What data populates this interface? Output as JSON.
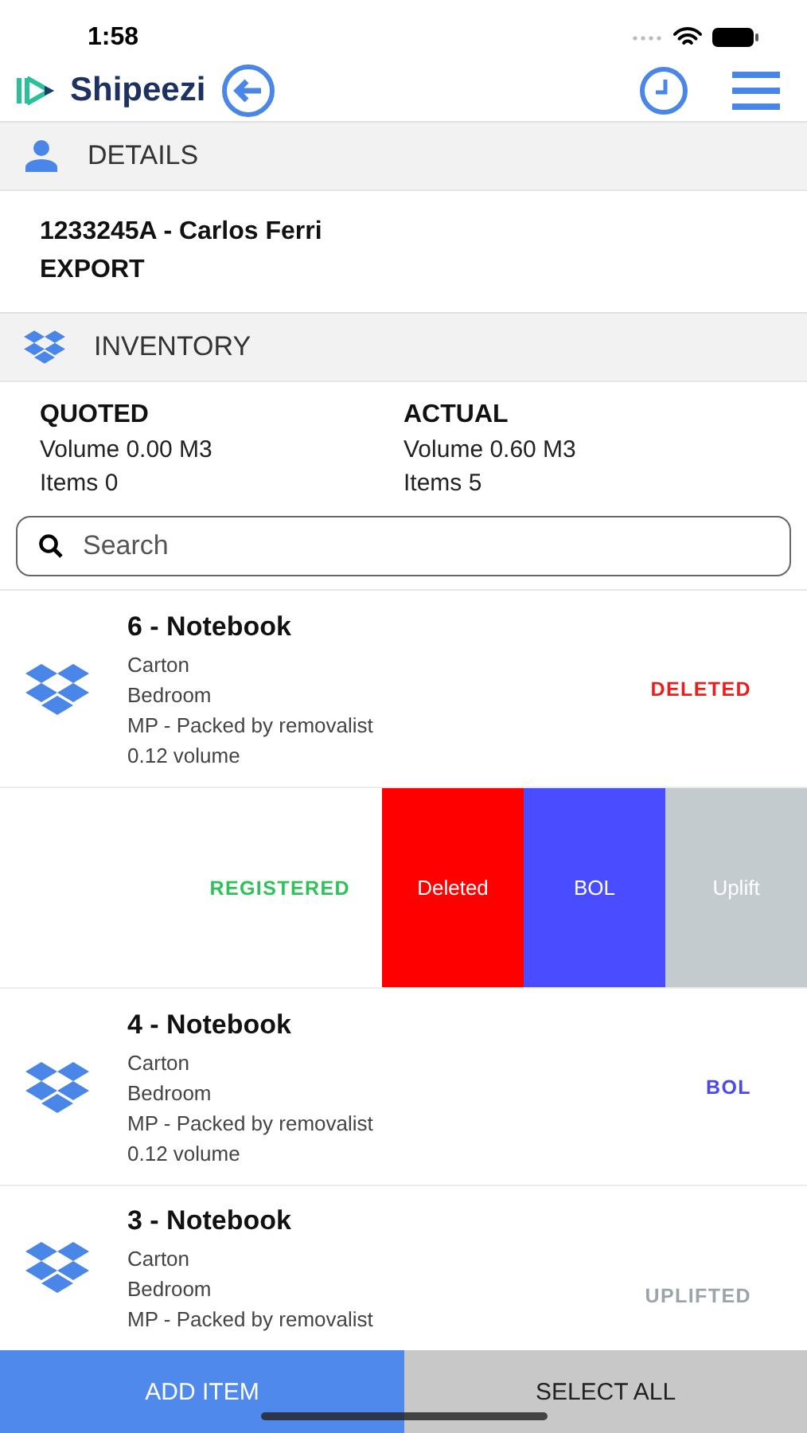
{
  "status_bar": {
    "time": "1:58"
  },
  "header": {
    "logo": "Shipeezi"
  },
  "details_section": {
    "title": "DETAILS",
    "reference": "1233245A - Carlos Ferri",
    "type": "EXPORT"
  },
  "inventory_section": {
    "title": "INVENTORY"
  },
  "summary": [
    {
      "heading": "QUOTED",
      "volume": "Volume 0.00 M3",
      "items": "Items 0"
    },
    {
      "heading": "ACTUAL",
      "volume": "Volume 0.60 M3",
      "items": "Items 5"
    }
  ],
  "search": {
    "placeholder": "Search"
  },
  "items": [
    {
      "kind": "item",
      "title": "6 - Notebook",
      "lines": [
        "Carton",
        "Bedroom",
        "MP - Packed by removalist",
        "0.12 volume"
      ],
      "status": {
        "label": "DELETED",
        "kind": "deleted"
      }
    },
    {
      "kind": "swiped",
      "status": {
        "label": "REGISTERED",
        "kind": "registered"
      },
      "actions": [
        {
          "label": "Deleted",
          "kind": "deleted"
        },
        {
          "label": "BOL",
          "kind": "bol"
        },
        {
          "label": "Uplift",
          "kind": "uplift"
        }
      ]
    },
    {
      "kind": "item",
      "title": "4 - Notebook",
      "lines": [
        "Carton",
        "Bedroom",
        "MP - Packed by removalist",
        "0.12 volume"
      ],
      "status": {
        "label": "BOL",
        "kind": "bol"
      }
    },
    {
      "kind": "item",
      "title": "3 - Notebook",
      "lines": [
        "Carton",
        "Bedroom",
        "MP - Packed by removalist"
      ],
      "status": {
        "label": "UPLIFTED",
        "kind": "uplifted"
      }
    }
  ],
  "footer": {
    "buttons": [
      {
        "label": "ADD ITEM",
        "kind": "primary"
      },
      {
        "label": "SELECT ALL",
        "kind": "secondary"
      }
    ]
  }
}
